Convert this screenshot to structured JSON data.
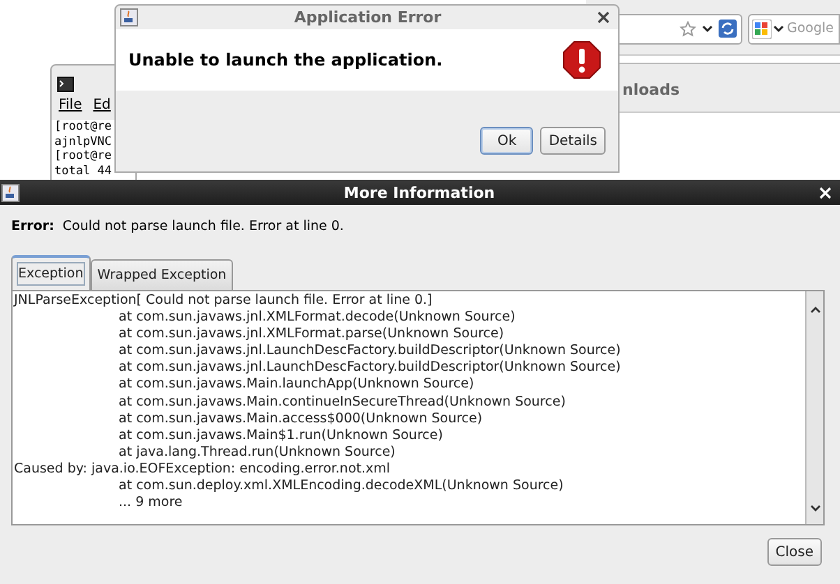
{
  "background": {
    "browser": {
      "search_placeholder": "Google"
    },
    "downloads": {
      "title": "nloads"
    },
    "terminal": {
      "menu": [
        "File",
        "Ed"
      ],
      "lines": [
        "[root@re",
        "ajnlpVNC",
        "[root@re",
        "total 44"
      ]
    }
  },
  "error_dialog": {
    "title": "Application Error",
    "message": "Unable to launch the application.",
    "buttons": [
      {
        "label": "Ok",
        "selected": true
      },
      {
        "label": "Details",
        "selected": false
      }
    ]
  },
  "info_dialog": {
    "title": "More Information",
    "error_label": "Error:",
    "error_text": "Could not parse launch file. Error at line 0.",
    "tabs": [
      {
        "label": "Exception",
        "selected": true
      },
      {
        "label": "Wrapped Exception",
        "selected": false
      }
    ],
    "trace": [
      {
        "kind": "head",
        "text": "JNLParseException[ Could not parse launch file. Error at line 0.]"
      },
      {
        "kind": "frame",
        "text": "at com.sun.javaws.jnl.XMLFormat.decode(Unknown Source)"
      },
      {
        "kind": "frame",
        "text": "at com.sun.javaws.jnl.XMLFormat.parse(Unknown Source)"
      },
      {
        "kind": "frame",
        "text": "at com.sun.javaws.jnl.LaunchDescFactory.buildDescriptor(Unknown Source)"
      },
      {
        "kind": "frame",
        "text": "at com.sun.javaws.jnl.LaunchDescFactory.buildDescriptor(Unknown Source)"
      },
      {
        "kind": "frame",
        "text": "at com.sun.javaws.Main.launchApp(Unknown Source)"
      },
      {
        "kind": "frame",
        "text": "at com.sun.javaws.Main.continueInSecureThread(Unknown Source)"
      },
      {
        "kind": "frame",
        "text": "at com.sun.javaws.Main.access$000(Unknown Source)"
      },
      {
        "kind": "frame",
        "text": "at com.sun.javaws.Main$1.run(Unknown Source)"
      },
      {
        "kind": "frame",
        "text": "at java.lang.Thread.run(Unknown Source)"
      },
      {
        "kind": "head",
        "text": "Caused by: java.io.EOFException: encoding.error.not.xml"
      },
      {
        "kind": "frame",
        "text": "at com.sun.deploy.xml.XMLEncoding.decodeXML(Unknown Source)"
      },
      {
        "kind": "frame",
        "text": "... 9 more"
      }
    ],
    "buttons": [
      "Close"
    ]
  }
}
